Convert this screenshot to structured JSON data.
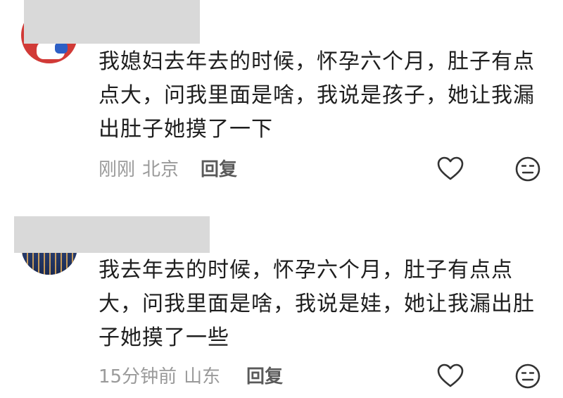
{
  "comments": [
    {
      "text": "我媳妇去年去的时候，怀孕六个月，肚子有点点大，问我里面是啥，我说是孩子，她让我漏出肚子她摸了一下",
      "time": "刚刚",
      "location": "北京",
      "reply_label": "回复",
      "like_icon": "heart-outline-icon",
      "reaction_icon": "neutral-face-icon"
    },
    {
      "text": "我去年去的时候，怀孕六个月，肚子有点点大，问我里面是啥，我说是娃，她让我漏出肚子她摸了一些",
      "time": "15分钟前",
      "location": "山东",
      "reply_label": "回复",
      "like_icon": "heart-outline-icon",
      "reaction_icon": "neutral-face-icon"
    }
  ],
  "colors": {
    "text": "#1e1e1e",
    "meta": "#9a9a9a",
    "reply": "#5a5a5a",
    "icon": "#333333",
    "mask": "#d9d9d9"
  }
}
